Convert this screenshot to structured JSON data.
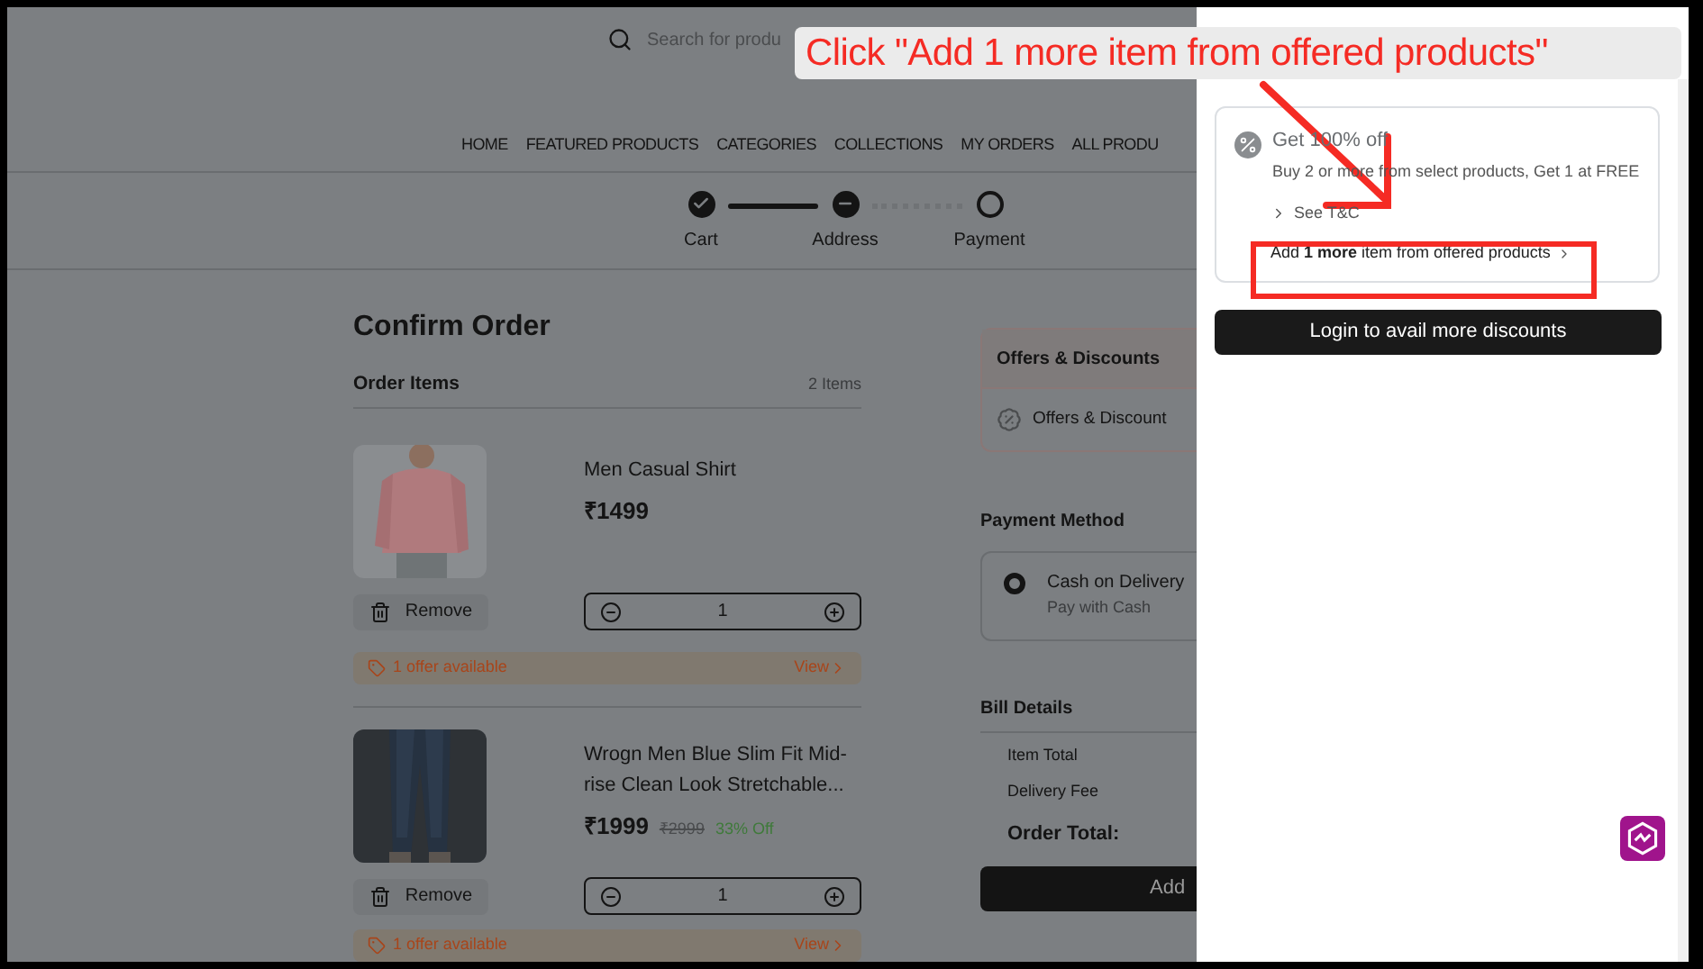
{
  "header": {
    "search": {
      "placeholder": "Search for produ"
    }
  },
  "nav": [
    {
      "label": "HOME"
    },
    {
      "label": "FEATURED PRODUCTS"
    },
    {
      "label": "CATEGORIES"
    },
    {
      "label": "COLLECTIONS"
    },
    {
      "label": "MY ORDERS"
    },
    {
      "label": "ALL PRODU"
    }
  ],
  "stepper": [
    {
      "label": "Cart",
      "completed": true,
      "current": false
    },
    {
      "label": "Address",
      "completed": false,
      "current": true
    },
    {
      "label": "Payment",
      "completed": false,
      "current": false
    }
  ],
  "order": {
    "title": "Confirm Order",
    "items_heading": "Order Items",
    "items_count": "2 Items",
    "items": [
      {
        "name": "Men Casual Shirt",
        "price": "₹1499",
        "remove": "Remove",
        "quantity": "1",
        "offer": "1 offer available",
        "offer_link": "View"
      },
      {
        "name": "Wrogn Men Blue Slim Fit Mid-rise Clean Look Stretchable...",
        "price": "₹1999",
        "mrp": "₹2999",
        "discount": "33% Off",
        "remove": "Remove",
        "quantity": "1",
        "offer": "1 offer available",
        "offer_link": "View"
      }
    ]
  },
  "offers": {
    "title": "Offers & Discounts",
    "row": "Offers & Discount"
  },
  "payment": {
    "title": "Payment Method",
    "options": [
      {
        "label": "Cash on Delivery",
        "sub": "Pay with Cash",
        "selected": true
      }
    ]
  },
  "bill": {
    "title": "Bill Details",
    "rows": [
      {
        "label": "Item Total"
      },
      {
        "label": "Delivery Fee"
      }
    ],
    "total": "Order Total:",
    "button": "Add"
  },
  "drawer": {
    "offer": {
      "title": "Get 100% off",
      "description": "Buy 2 or more from select products, Get 1 at FREE",
      "terms": "See T&C",
      "progress": "Add **1 more** item from offered products"
    },
    "login_button": "Login to avail more discounts"
  },
  "annotation": {
    "text": "Click \"Add 1 more item from offered products\""
  }
}
